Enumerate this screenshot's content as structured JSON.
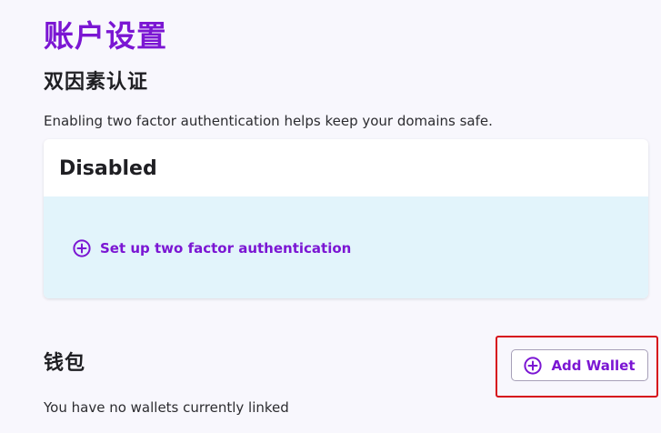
{
  "page": {
    "title": "账户设置"
  },
  "two_factor": {
    "title": "双因素认证",
    "description": "Enabling two factor authentication helps keep your domains safe.",
    "status": "Disabled",
    "setup_label": "Set up two factor authentication",
    "setup_icon": "plus-circle-icon"
  },
  "wallet": {
    "title": "钱包",
    "add_label": "Add Wallet",
    "add_icon": "plus-circle-icon",
    "empty_text": "You have no wallets currently linked"
  },
  "colors": {
    "accent": "#7b16d3",
    "card_body": "#e2f4fb",
    "background": "#f8f7fd",
    "highlight": "#d6101b"
  }
}
